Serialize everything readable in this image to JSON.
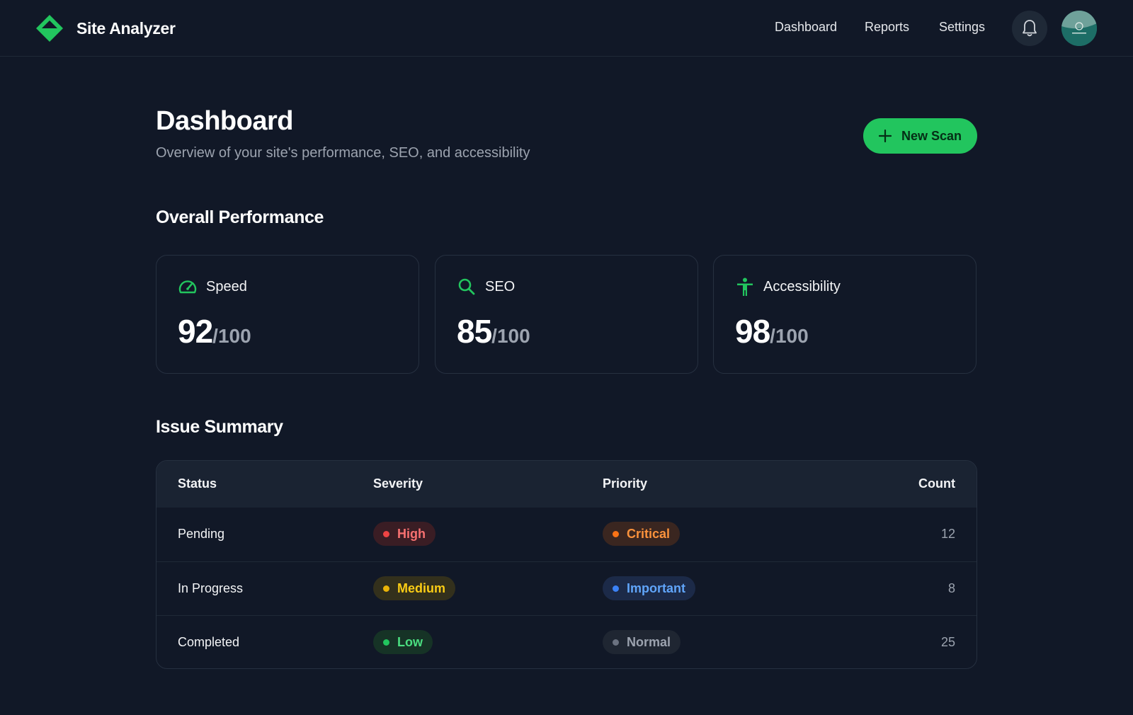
{
  "app": {
    "name": "Site Analyzer"
  },
  "nav": {
    "items": [
      "Dashboard",
      "Reports",
      "Settings"
    ]
  },
  "header": {
    "title": "Dashboard",
    "subtitle": "Overview of your site's performance, SEO, and accessibility",
    "new_scan_label": "New Scan"
  },
  "performance": {
    "title": "Overall Performance",
    "cards": [
      {
        "label": "Speed",
        "score": "92",
        "max": "/100",
        "icon": "speedometer-icon"
      },
      {
        "label": "SEO",
        "score": "85",
        "max": "/100",
        "icon": "search-icon"
      },
      {
        "label": "Accessibility",
        "score": "98",
        "max": "/100",
        "icon": "accessibility-icon"
      }
    ]
  },
  "issues": {
    "title": "Issue Summary",
    "headers": [
      "Status",
      "Severity",
      "Priority",
      "Count"
    ],
    "rows": [
      {
        "status": "Pending",
        "severity": "High",
        "priority": "Critical",
        "count": "12"
      },
      {
        "status": "In Progress",
        "severity": "Medium",
        "priority": "Important",
        "count": "8"
      },
      {
        "status": "Completed",
        "severity": "Low",
        "priority": "Normal",
        "count": "25"
      }
    ]
  },
  "colors": {
    "accent": "#22c55e",
    "background": "#111827",
    "high": "#ef4444",
    "critical": "#f97316",
    "medium": "#eab308",
    "important": "#3b82f6",
    "low": "#22c55e",
    "normal": "#6b7280"
  }
}
